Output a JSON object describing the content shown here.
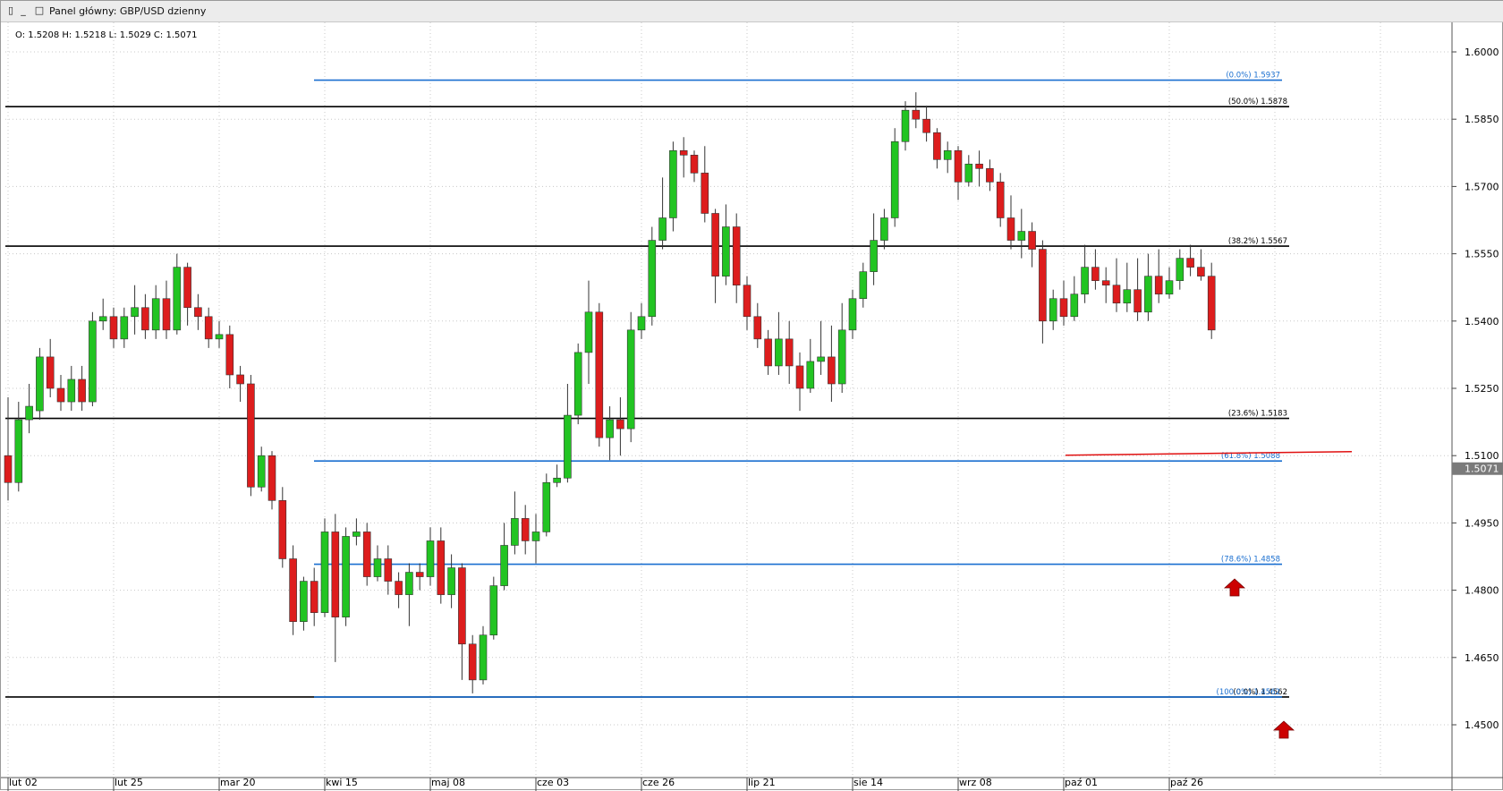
{
  "window": {
    "title": "Panel główny: GBP/USD dzienny",
    "ohlc_readout": "O: 1.5208 H: 1.5218 L: 1.5029 C: 1.5071"
  },
  "colors": {
    "bull": "#22c422",
    "bear": "#dd1d1d",
    "fib_blue": "#1a6fd0",
    "level_black": "#000000",
    "support_red": "#e01010",
    "grid": "#c8c8c8",
    "arrow": "#cc0000"
  },
  "chart_data": {
    "type": "candlestick",
    "instrument": "GBP/USD",
    "timeframe": "dzienny",
    "ylim": [
      1.444,
      1.6095
    ],
    "y_ticks": [
      "1.6000",
      "1.5850",
      "1.5700",
      "1.5550",
      "1.5400",
      "1.5250",
      "1.5100",
      "1.4950",
      "1.4800",
      "1.4650",
      "1.4500"
    ],
    "x_ticks": [
      "lut 02",
      "lut 25",
      "mar 20",
      "kwi 15",
      "maj 08",
      "cze 03",
      "cze 26",
      "lip 21",
      "sie 14",
      "wrz 08",
      "paź 01",
      "paź 26"
    ],
    "last_price": "1.5071",
    "horizontal_levels": [
      {
        "kind": "black",
        "value": 1.5878,
        "label": "(50.0%) 1.5878"
      },
      {
        "kind": "black",
        "value": 1.5567,
        "label": "(38.2%) 1.5567"
      },
      {
        "kind": "black",
        "value": 1.5183,
        "label": "(23.6%) 1.5183"
      },
      {
        "kind": "black",
        "value": 1.4562,
        "label": "(0.0%) 1.4562"
      },
      {
        "kind": "blue",
        "value": 1.5937,
        "label": "(0.0%) 1.5937"
      },
      {
        "kind": "blue",
        "value": 1.5088,
        "label": "(61.8%) 1.5088"
      },
      {
        "kind": "blue",
        "value": 1.4858,
        "label": "(78.6%) 1.4858"
      },
      {
        "kind": "blue",
        "value": 1.4562,
        "label": "(100.0%) 1.4562"
      }
    ],
    "support_line": {
      "value": 1.5105,
      "from_index": 98,
      "to_index": 125
    },
    "candles": [
      [
        1.51,
        1.504,
        1.523,
        1.5
      ],
      [
        1.504,
        1.518,
        1.522,
        1.502
      ],
      [
        1.518,
        1.521,
        1.526,
        1.515
      ],
      [
        1.52,
        1.532,
        1.534,
        1.518
      ],
      [
        1.532,
        1.525,
        1.536,
        1.523
      ],
      [
        1.525,
        1.522,
        1.528,
        1.52
      ],
      [
        1.522,
        1.527,
        1.53,
        1.52
      ],
      [
        1.527,
        1.522,
        1.53,
        1.52
      ],
      [
        1.522,
        1.54,
        1.542,
        1.521
      ],
      [
        1.54,
        1.541,
        1.545,
        1.538
      ],
      [
        1.541,
        1.536,
        1.543,
        1.534
      ],
      [
        1.536,
        1.541,
        1.543,
        1.534
      ],
      [
        1.541,
        1.543,
        1.548,
        1.537
      ],
      [
        1.543,
        1.538,
        1.546,
        1.536
      ],
      [
        1.538,
        1.545,
        1.548,
        1.536
      ],
      [
        1.545,
        1.538,
        1.549,
        1.536
      ],
      [
        1.538,
        1.552,
        1.555,
        1.537
      ],
      [
        1.552,
        1.543,
        1.553,
        1.539
      ],
      [
        1.543,
        1.541,
        1.546,
        1.538
      ],
      [
        1.541,
        1.536,
        1.543,
        1.534
      ],
      [
        1.536,
        1.537,
        1.54,
        1.534
      ],
      [
        1.537,
        1.528,
        1.539,
        1.525
      ],
      [
        1.528,
        1.526,
        1.53,
        1.522
      ],
      [
        1.526,
        1.503,
        1.528,
        1.501
      ],
      [
        1.503,
        1.51,
        1.512,
        1.502
      ],
      [
        1.51,
        1.5,
        1.511,
        1.498
      ],
      [
        1.5,
        1.487,
        1.503,
        1.485
      ],
      [
        1.487,
        1.473,
        1.49,
        1.47
      ],
      [
        1.473,
        1.482,
        1.483,
        1.471
      ],
      [
        1.482,
        1.475,
        1.485,
        1.472
      ],
      [
        1.475,
        1.493,
        1.496,
        1.474
      ],
      [
        1.493,
        1.474,
        1.497,
        1.464
      ],
      [
        1.474,
        1.492,
        1.494,
        1.472
      ],
      [
        1.492,
        1.493,
        1.496,
        1.49
      ],
      [
        1.493,
        1.483,
        1.495,
        1.481
      ],
      [
        1.483,
        1.487,
        1.49,
        1.482
      ],
      [
        1.487,
        1.482,
        1.49,
        1.479
      ],
      [
        1.482,
        1.479,
        1.484,
        1.476
      ],
      [
        1.479,
        1.484,
        1.486,
        1.472
      ],
      [
        1.484,
        1.483,
        1.486,
        1.48
      ],
      [
        1.483,
        1.491,
        1.494,
        1.481
      ],
      [
        1.491,
        1.479,
        1.494,
        1.477
      ],
      [
        1.479,
        1.485,
        1.488,
        1.476
      ],
      [
        1.485,
        1.468,
        1.486,
        1.46
      ],
      [
        1.468,
        1.46,
        1.47,
        1.457
      ],
      [
        1.46,
        1.47,
        1.472,
        1.459
      ],
      [
        1.47,
        1.481,
        1.483,
        1.469
      ],
      [
        1.481,
        1.49,
        1.495,
        1.48
      ],
      [
        1.49,
        1.496,
        1.502,
        1.488
      ],
      [
        1.496,
        1.491,
        1.499,
        1.488
      ],
      [
        1.491,
        1.493,
        1.497,
        1.486
      ],
      [
        1.493,
        1.504,
        1.506,
        1.492
      ],
      [
        1.504,
        1.505,
        1.508,
        1.503
      ],
      [
        1.505,
        1.519,
        1.526,
        1.504
      ],
      [
        1.519,
        1.533,
        1.535,
        1.517
      ],
      [
        1.533,
        1.542,
        1.549,
        1.526
      ],
      [
        1.542,
        1.514,
        1.544,
        1.512
      ],
      [
        1.514,
        1.518,
        1.521,
        1.509
      ],
      [
        1.518,
        1.516,
        1.523,
        1.51
      ],
      [
        1.516,
        1.538,
        1.542,
        1.513
      ],
      [
        1.538,
        1.541,
        1.544,
        1.536
      ],
      [
        1.541,
        1.558,
        1.561,
        1.539
      ],
      [
        1.558,
        1.563,
        1.572,
        1.556
      ],
      [
        1.563,
        1.578,
        1.58,
        1.56
      ],
      [
        1.578,
        1.577,
        1.581,
        1.572
      ],
      [
        1.577,
        1.573,
        1.578,
        1.571
      ],
      [
        1.573,
        1.564,
        1.579,
        1.562
      ],
      [
        1.564,
        1.55,
        1.565,
        1.544
      ],
      [
        1.55,
        1.561,
        1.566,
        1.548
      ],
      [
        1.561,
        1.548,
        1.564,
        1.544
      ],
      [
        1.548,
        1.541,
        1.55,
        1.538
      ],
      [
        1.541,
        1.536,
        1.544,
        1.534
      ],
      [
        1.536,
        1.53,
        1.538,
        1.528
      ],
      [
        1.53,
        1.536,
        1.542,
        1.528
      ],
      [
        1.536,
        1.53,
        1.54,
        1.526
      ],
      [
        1.53,
        1.525,
        1.533,
        1.52
      ],
      [
        1.525,
        1.531,
        1.536,
        1.524
      ],
      [
        1.531,
        1.532,
        1.54,
        1.528
      ],
      [
        1.532,
        1.526,
        1.539,
        1.522
      ],
      [
        1.526,
        1.538,
        1.544,
        1.524
      ],
      [
        1.538,
        1.545,
        1.547,
        1.536
      ],
      [
        1.545,
        1.551,
        1.553,
        1.543
      ],
      [
        1.551,
        1.558,
        1.564,
        1.548
      ],
      [
        1.558,
        1.563,
        1.565,
        1.556
      ],
      [
        1.563,
        1.58,
        1.583,
        1.561
      ],
      [
        1.58,
        1.587,
        1.589,
        1.578
      ],
      [
        1.587,
        1.585,
        1.591,
        1.583
      ],
      [
        1.585,
        1.582,
        1.588,
        1.58
      ],
      [
        1.582,
        1.576,
        1.583,
        1.574
      ],
      [
        1.576,
        1.578,
        1.58,
        1.573
      ],
      [
        1.578,
        1.571,
        1.579,
        1.567
      ],
      [
        1.571,
        1.575,
        1.577,
        1.57
      ],
      [
        1.575,
        1.574,
        1.578,
        1.57
      ],
      [
        1.574,
        1.571,
        1.576,
        1.569
      ],
      [
        1.571,
        1.563,
        1.573,
        1.561
      ],
      [
        1.563,
        1.558,
        1.568,
        1.556
      ],
      [
        1.558,
        1.56,
        1.565,
        1.554
      ],
      [
        1.56,
        1.556,
        1.562,
        1.552
      ],
      [
        1.556,
        1.54,
        1.558,
        1.535
      ],
      [
        1.54,
        1.545,
        1.547,
        1.538
      ],
      [
        1.545,
        1.541,
        1.549,
        1.539
      ],
      [
        1.541,
        1.546,
        1.55,
        1.54
      ],
      [
        1.546,
        1.552,
        1.557,
        1.544
      ],
      [
        1.552,
        1.549,
        1.556,
        1.547
      ],
      [
        1.549,
        1.548,
        1.552,
        1.544
      ],
      [
        1.548,
        1.544,
        1.554,
        1.542
      ],
      [
        1.544,
        1.547,
        1.553,
        1.542
      ],
      [
        1.547,
        1.542,
        1.554,
        1.54
      ],
      [
        1.542,
        1.55,
        1.555,
        1.54
      ],
      [
        1.55,
        1.546,
        1.556,
        1.544
      ],
      [
        1.546,
        1.549,
        1.552,
        1.545
      ],
      [
        1.549,
        1.554,
        1.556,
        1.547
      ],
      [
        1.554,
        1.552,
        1.557,
        1.55
      ],
      [
        1.552,
        1.55,
        1.556,
        1.549
      ],
      [
        1.55,
        1.538,
        1.553,
        1.536
      ]
    ]
  }
}
